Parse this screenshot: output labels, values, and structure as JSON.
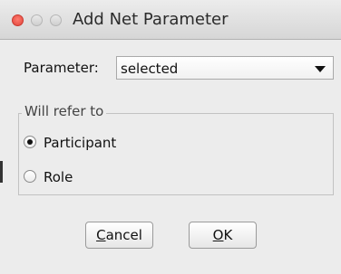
{
  "window": {
    "title": "Add Net Parameter"
  },
  "parameter": {
    "label": "Parameter:",
    "selected_value": "selected"
  },
  "refer_group": {
    "title": "Will refer to",
    "options": [
      {
        "label": "Participant",
        "checked": true
      },
      {
        "label": "Role",
        "checked": false
      }
    ]
  },
  "buttons": {
    "cancel_label": "Cancel",
    "cancel_mnemonic": "C",
    "cancel_rest": "ancel",
    "ok_label": "OK",
    "ok_mnemonic": "O",
    "ok_rest": "K"
  },
  "colors": {
    "close_button": "#e0443a",
    "window_background": "#ececec"
  }
}
